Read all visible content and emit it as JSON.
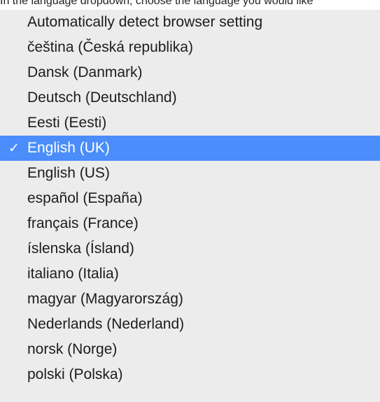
{
  "page": {
    "instruction": "In the language dropdown, choose the language you would like"
  },
  "language_menu": {
    "selected_index": 5,
    "check_glyph": "✓",
    "selected_color": "#4a8dfb",
    "options": [
      "Automatically detect browser setting",
      "čeština (Česká republika)",
      "Dansk (Danmark)",
      "Deutsch (Deutschland)",
      "Eesti (Eesti)",
      "English (UK)",
      "English (US)",
      "español (España)",
      "français (France)",
      "íslenska (Ísland)",
      "italiano (Italia)",
      "magyar (Magyarország)",
      "Nederlands (Nederland)",
      "norsk (Norge)",
      "polski (Polska)"
    ]
  }
}
